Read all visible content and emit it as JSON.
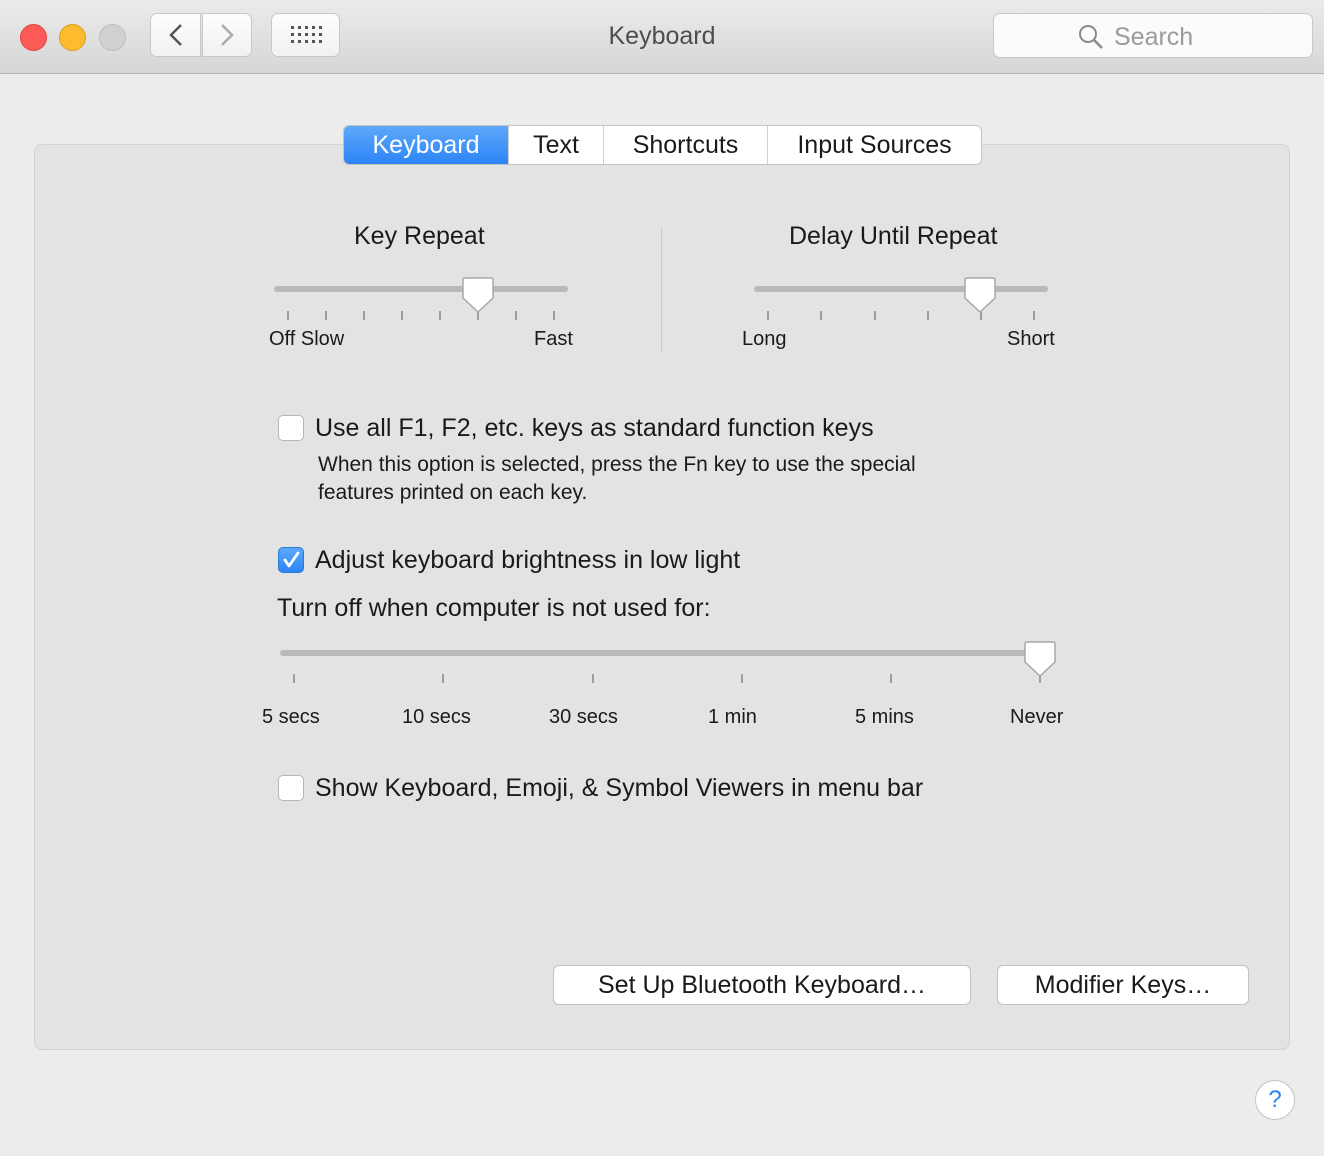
{
  "window": {
    "title": "Keyboard"
  },
  "search": {
    "placeholder": "Search"
  },
  "tabs": [
    {
      "label": "Keyboard",
      "selected": true
    },
    {
      "label": "Text",
      "selected": false
    },
    {
      "label": "Shortcuts",
      "selected": false
    },
    {
      "label": "Input Sources",
      "selected": false
    }
  ],
  "key_repeat": {
    "title": "Key Repeat",
    "min_label": "Off Slow",
    "max_label": "Fast",
    "value_fraction": 0.69
  },
  "delay_until_repeat": {
    "title": "Delay Until Repeat",
    "min_label": "Long",
    "max_label": "Short",
    "value_fraction": 0.78
  },
  "function_keys": {
    "label": "Use all F1, F2, etc. keys as standard function keys",
    "checked": false,
    "help_line1": "When this option is selected, press the Fn key to use the special",
    "help_line2": "features printed on each key."
  },
  "brightness": {
    "label": "Adjust keyboard brightness in low light",
    "checked": true
  },
  "turn_off": {
    "label": "Turn off when computer is not used for:",
    "options": [
      "5 secs",
      "10 secs",
      "30 secs",
      "1 min",
      "5 mins",
      "Never"
    ],
    "selected": "Never"
  },
  "viewers": {
    "label": "Show Keyboard, Emoji, & Symbol Viewers in menu bar",
    "checked": false
  },
  "buttons": {
    "bluetooth": "Set Up Bluetooth Keyboard…",
    "modifier": "Modifier Keys…",
    "help": "?"
  },
  "colors": {
    "accent": "#2d84f6",
    "close": "#fc5b57",
    "minimize": "#fdbc2e"
  }
}
